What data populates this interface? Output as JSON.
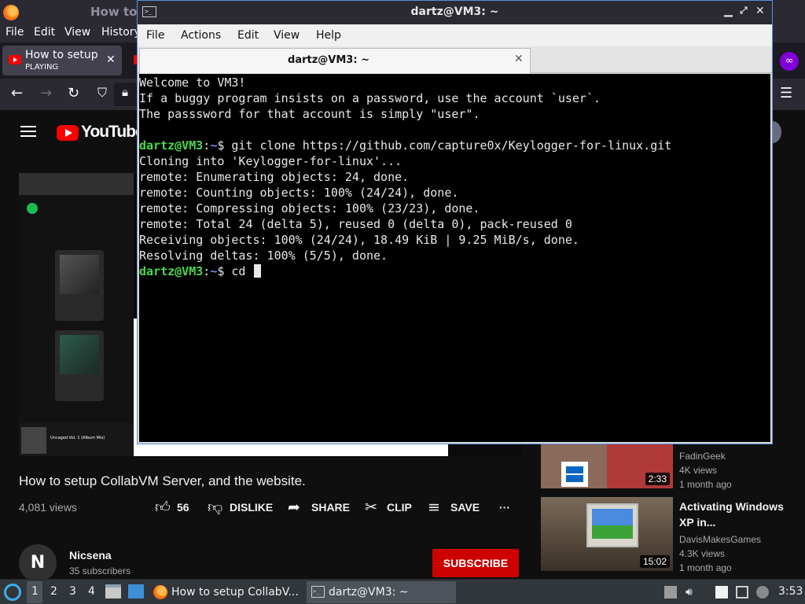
{
  "firefox": {
    "window_title": "How to",
    "menu": [
      "File",
      "Edit",
      "View",
      "History"
    ],
    "tab": {
      "title": "How to setup C",
      "status": "PLAYING",
      "close": "✕"
    }
  },
  "youtube": {
    "logo": "YouTube",
    "video": {
      "title": "How to setup CollabVM Server, and the website.",
      "views": "4,081 views",
      "likes": "56",
      "dislike_label": "DISLIKE",
      "share_label": "SHARE",
      "clip_label": "CLIP",
      "save_label": "SAVE",
      "more": "···"
    },
    "channel": {
      "initial": "N",
      "name": "Nicsena",
      "subscribers": "35 subscribers",
      "subscribe_label": "SUBSCRIBE"
    },
    "embedded_frame": {
      "album_label": "Uncaged Vol. 1 (Album Mix)"
    },
    "recommendations": [
      {
        "channel": "FadinGeek",
        "views": "4K views",
        "age": "1 month ago",
        "duration": "2:33"
      },
      {
        "title": "Activating Windows XP in...",
        "channel": "DavisMakesGames",
        "views": "4.3K views",
        "age": "1 month ago",
        "duration": "15:02"
      }
    ]
  },
  "terminal": {
    "window_title": "dartz@VM3: ~",
    "tab_title": "dartz@VM3: ~",
    "menu": [
      "File",
      "Actions",
      "Edit",
      "View",
      "Help"
    ],
    "prompt_user": "dartz@VM3",
    "prompt_sep": ":",
    "prompt_path": "~",
    "prompt_end": "$ ",
    "lines": [
      "Welcome to VM3!",
      "If a buggy program insists on a password, use the account `user`.",
      "The passsword for that account is simply \"user\".",
      ""
    ],
    "command1": "git clone https://github.com/capture0x/Keylogger-for-linux.git",
    "output": [
      "Cloning into 'Keylogger-for-linux'...",
      "remote: Enumerating objects: 24, done.",
      "remote: Counting objects: 100% (24/24), done.",
      "remote: Compressing objects: 100% (23/23), done.",
      "remote: Total 24 (delta 5), reused 0 (delta 0), pack-reused 0",
      "Receiving objects: 100% (24/24), 18.49 KiB | 9.25 MiB/s, done.",
      "Resolving deltas: 100% (5/5), done."
    ],
    "command2": "cd "
  },
  "taskbar": {
    "workspaces": [
      "1",
      "2",
      "3",
      "4"
    ],
    "tasks": [
      "How to setup CollabV...",
      "dartz@VM3: ~"
    ],
    "clock": "3:53"
  },
  "colors": {
    "prompt_user": "#4ad94a",
    "prompt_path": "#6c8dff",
    "subscribe": "#cc0000",
    "window_border": "#5a8fd8"
  }
}
